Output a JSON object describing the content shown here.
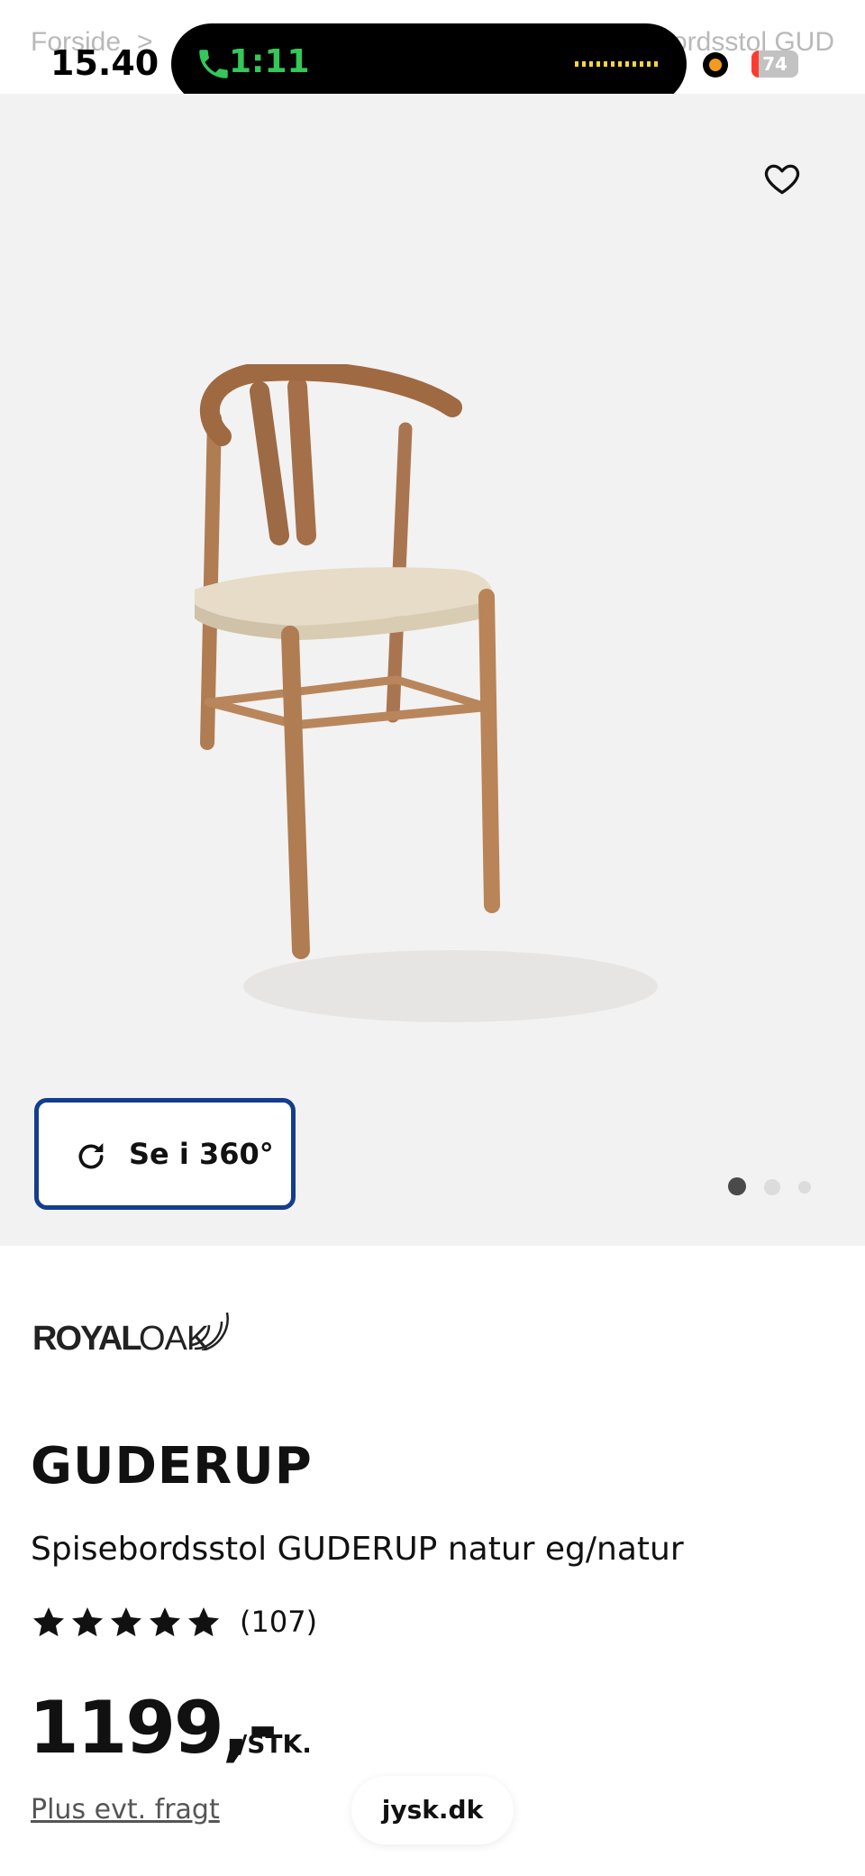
{
  "status_bar": {
    "time": "15.40",
    "call_timer": "1:11",
    "battery_level": "74",
    "breadcrumb_left": "Forside",
    "breadcrumb_separator": ">",
    "breadcrumb_right": "ordsstol GUD"
  },
  "gallery": {
    "button_360_label": "Se i 360°",
    "image_count": 3,
    "active_image_index": 0
  },
  "product": {
    "brand_part1": "ROYAL",
    "brand_part2": "OAK",
    "name": "GUDERUP",
    "description": "Spisebordsstol GUDERUP natur eg/natur",
    "rating_stars": 5,
    "review_count": "(107)",
    "price": "1199,-",
    "price_unit": "/STK.",
    "shipping_note": "Plus evt. fragt"
  },
  "browser": {
    "url": "jysk.dk"
  },
  "colors": {
    "accent_blue": "#143d8d",
    "call_green": "#34c759",
    "image_bg": "#f3f2f2"
  }
}
